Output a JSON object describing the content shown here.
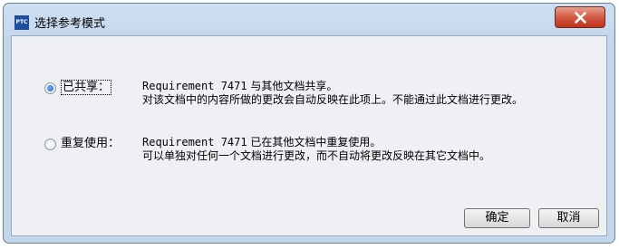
{
  "window": {
    "title": "选择参考模式",
    "app_icon_text": "PTC",
    "close_icon": "close-icon"
  },
  "options": [
    {
      "label": "已共享：",
      "selected": true,
      "desc_id": "Requirement 7471",
      "desc_rest": " 与其他文档共享。",
      "desc_line2": "对该文档中的内容所做的更改会自动反映在此项上。不能通过此文档进行更改。"
    },
    {
      "label": "重复使用：",
      "selected": false,
      "desc_id": "Requirement 7471",
      "desc_rest": " 已在其他文档中重复使用。",
      "desc_line2": "可以单独对任何一个文档进行更改，而不自动将更改反映在其它文档中。"
    }
  ],
  "buttons": {
    "ok": "确定",
    "cancel": "取消"
  },
  "colors": {
    "close_button": "#c1321a",
    "selected_radio": "#1b5fb2"
  }
}
